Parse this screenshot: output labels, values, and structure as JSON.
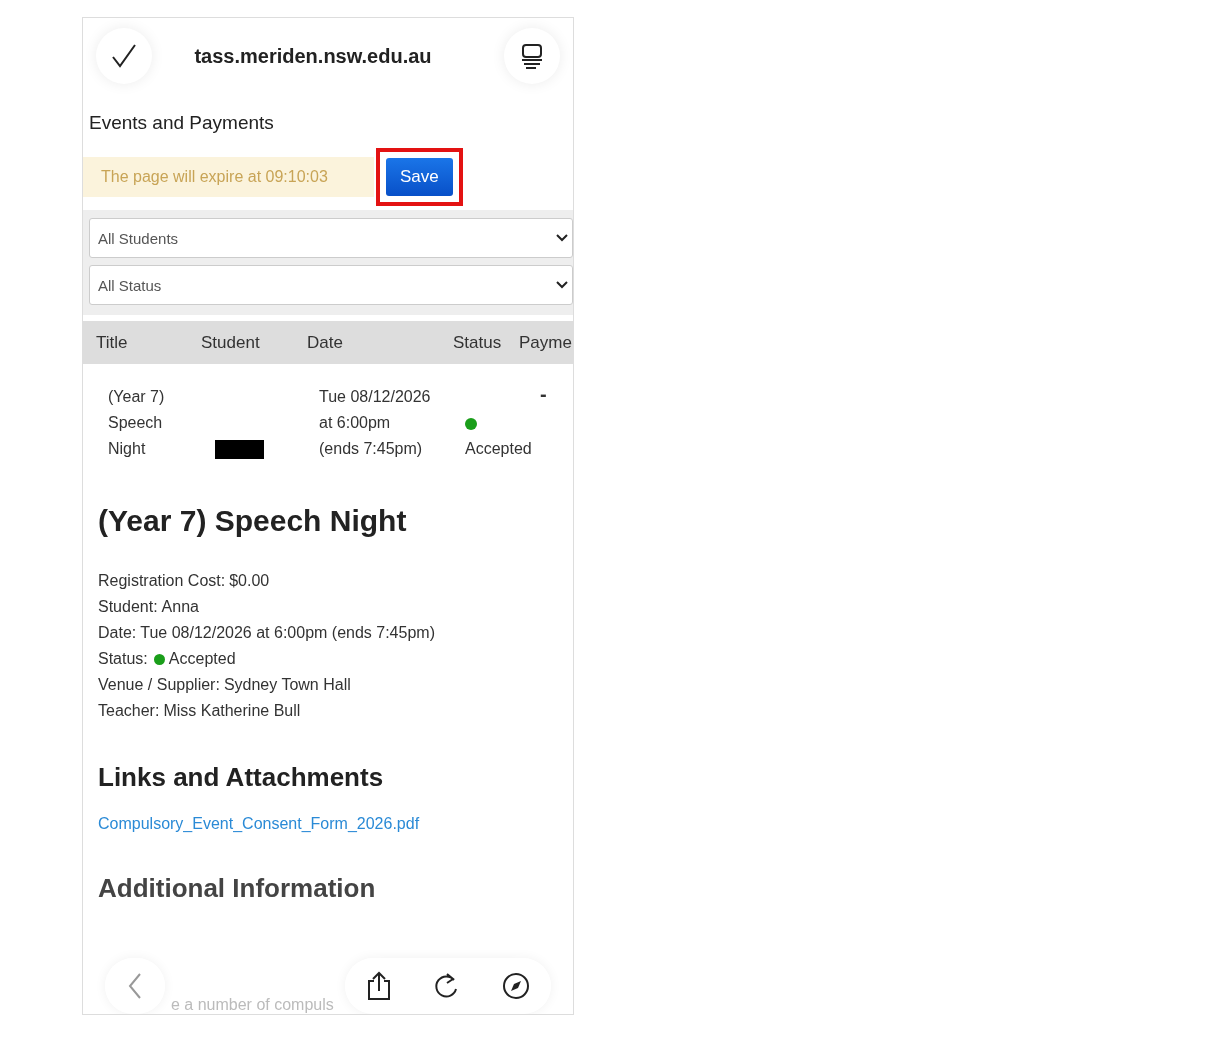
{
  "browser": {
    "url": "tass.meriden.nsw.edu.au"
  },
  "page_title": "Events and Payments",
  "expiry_notice": "The page will expire at 09:10:03",
  "save_button": {
    "label": "Save",
    "highlighted": true
  },
  "filters": [
    {
      "value": "All Students"
    },
    {
      "value": "All Status"
    }
  ],
  "table": {
    "columns": [
      "Title",
      "Student",
      "Date",
      "Status",
      "Payme"
    ],
    "rows": [
      {
        "title": "(Year 7) Speech Night",
        "student_redacted": true,
        "date": "Tue 08/12/2026 at 6:00pm (ends 7:45pm)",
        "status": "Accepted",
        "color": "#1a9e1a",
        "payment": "-"
      }
    ]
  },
  "details": {
    "heading": "(Year 7) Speech Night",
    "fields": [
      {
        "label": "Registration Cost:",
        "value": "$0.00"
      },
      {
        "label": "Student:",
        "value": "Anna"
      },
      {
        "label": "Date:",
        "value": "Tue 08/12/2026 at 6:00pm (ends 7:45pm)"
      },
      {
        "label": "Status:",
        "value": "Accepted",
        "color": "#1a9e1a"
      },
      {
        "label": "Venue / Supplier:",
        "value": "Sydney Town Hall"
      },
      {
        "label": "Teacher:",
        "value": "Miss Katherine Bull"
      }
    ]
  },
  "links_heading": "Links and Attachments",
  "attachment": "Compulsory_Event_Consent_Form_2026.pdf",
  "additional_heading": "Additional Information",
  "additional_text": "e a number of compuls"
}
